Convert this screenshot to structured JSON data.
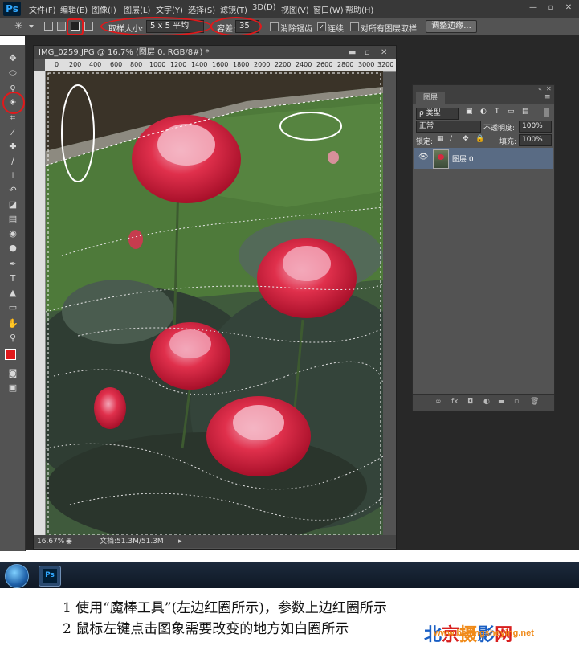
{
  "app": {
    "logo": "Ps"
  },
  "menu": [
    "文件(F)",
    "编辑(E)",
    "图像(I)",
    "图层(L)",
    "文字(Y)",
    "选择(S)",
    "滤镜(T)",
    "3D(D)",
    "视图(V)",
    "窗口(W)",
    "帮助(H)"
  ],
  "window_controls": {
    "minimize": "—",
    "restore": "▫",
    "close": "✕"
  },
  "options": {
    "sample_size_label": "取样大小:",
    "sample_size_value": "5 x 5 平均",
    "tolerance_label": "容差:",
    "tolerance_value": "35",
    "anti_alias_label": "消除锯齿",
    "contiguous_label": "连续",
    "all_layers_label": "对所有图层取样",
    "refine_edge_button": "调整边缘..."
  },
  "document": {
    "tab_title": "IMG_0259.JPG @ 16.7% (图层 0, RGB/8#) *",
    "ruler_ticks": [
      "0",
      "200",
      "400",
      "600",
      "800",
      "1000",
      "1200",
      "1400",
      "1600",
      "1800",
      "2000",
      "2200",
      "2400",
      "2600",
      "2800",
      "3000",
      "3200"
    ],
    "zoom": "16.67%",
    "doc_size": "文档:51.3M/51.3M"
  },
  "layers_panel": {
    "tab": "图层",
    "filter_kind": "ρ 类型",
    "blend_mode": "正常",
    "opacity_label": "不透明度:",
    "opacity_value": "100%",
    "lock_label": "锁定:",
    "fill_label": "填充:",
    "fill_value": "100%",
    "layers": [
      {
        "name": "图层 0"
      }
    ],
    "footer_icons": [
      "link-icon",
      "fx-icon",
      "mask-icon",
      "adjustment-icon",
      "group-icon",
      "new-layer-icon",
      "trash-icon"
    ],
    "footer_glyphs": [
      "∞",
      "fx",
      "◘",
      "◐",
      "▬",
      "▫",
      "🗑"
    ]
  },
  "taskbar": {
    "app_label": "Ps"
  },
  "captions": [
    "1 使用“魔棒工具”(左边红圈所示)，参数上边红圈所示",
    "2 鼠标左键点击图象需要改变的地方如白圈所示"
  ],
  "watermark": {
    "chars": [
      "北",
      "京",
      "摄",
      "影",
      "网"
    ],
    "url": "www.beijingsheying.net",
    "colors": [
      "#1a5fc4",
      "#d81e1e",
      "#f08a18",
      "#1a5fc4",
      "#d81e1e"
    ]
  },
  "colors": {
    "annotation_red": "#e0191b",
    "foreground_swatch": "#e0191b",
    "layer_selected": "#596b84"
  }
}
